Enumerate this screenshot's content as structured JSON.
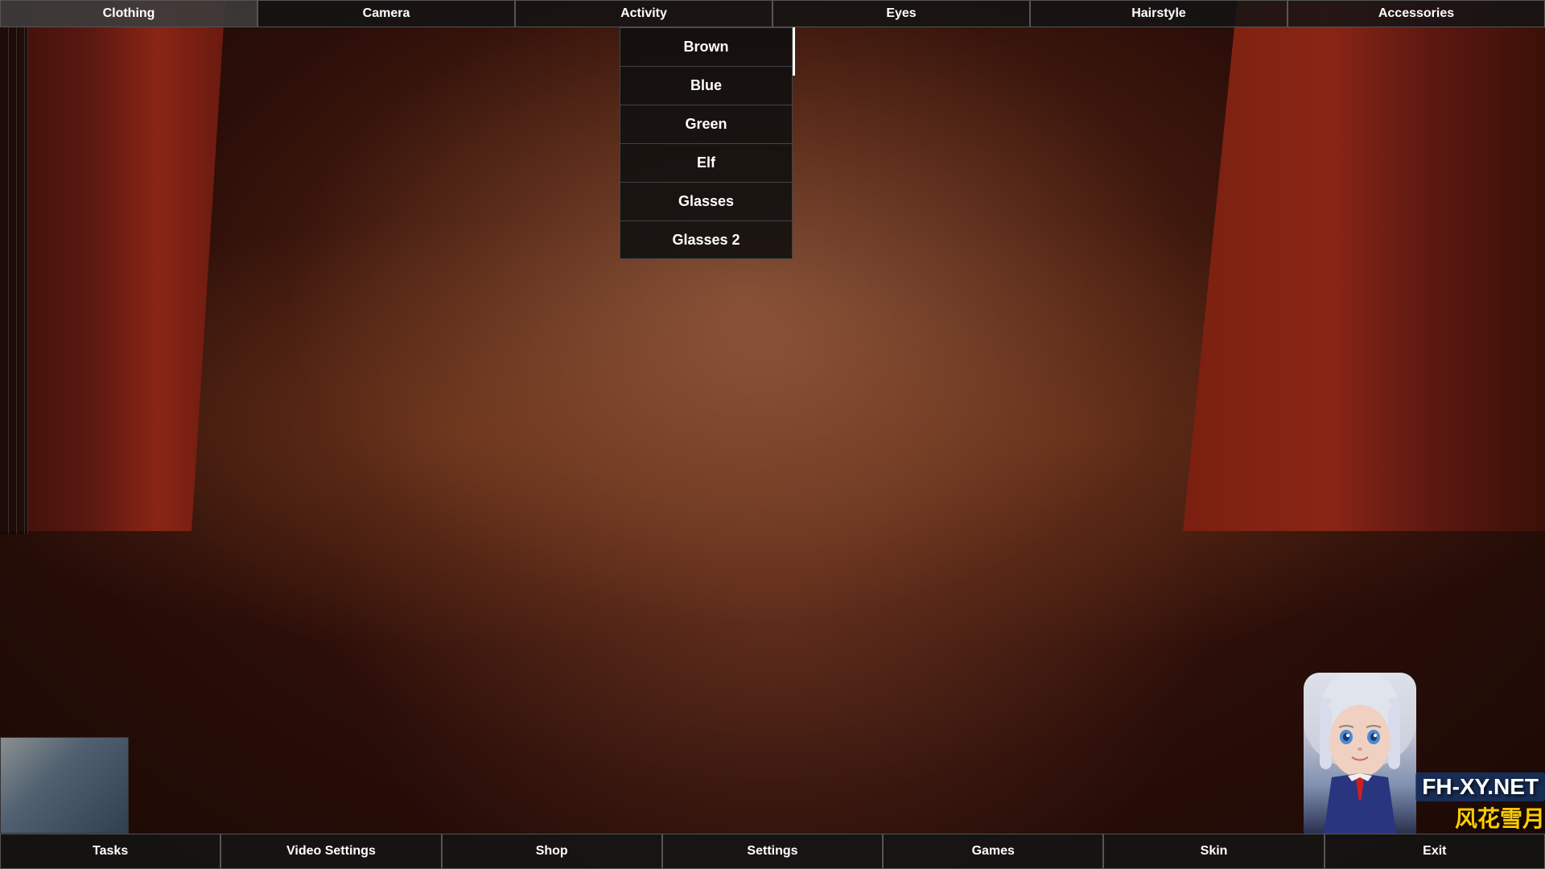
{
  "top_nav": {
    "buttons": [
      {
        "id": "clothing",
        "label": "Clothing"
      },
      {
        "id": "camera",
        "label": "Camera"
      },
      {
        "id": "activity",
        "label": "Activity"
      },
      {
        "id": "eyes",
        "label": "Eyes"
      },
      {
        "id": "hairstyle",
        "label": "Hairstyle"
      },
      {
        "id": "accessories",
        "label": "Accessories"
      }
    ]
  },
  "eyes_options": {
    "items": [
      {
        "id": "brown",
        "label": "Brown"
      },
      {
        "id": "blue",
        "label": "Blue"
      },
      {
        "id": "green",
        "label": "Green"
      },
      {
        "id": "elf",
        "label": "Elf"
      },
      {
        "id": "glasses",
        "label": "Glasses"
      },
      {
        "id": "glasses2",
        "label": "Glasses 2"
      }
    ]
  },
  "bottom_nav": {
    "buttons": [
      {
        "id": "tasks",
        "label": "Tasks"
      },
      {
        "id": "video-settings",
        "label": "Video Settings"
      },
      {
        "id": "shop",
        "label": "Shop"
      },
      {
        "id": "settings",
        "label": "Settings"
      },
      {
        "id": "games",
        "label": "Games"
      },
      {
        "id": "skin",
        "label": "Skin"
      },
      {
        "id": "exit",
        "label": "Exit"
      }
    ]
  },
  "branding": {
    "site": "FH-XY.NET",
    "chinese": "风花雪月"
  }
}
